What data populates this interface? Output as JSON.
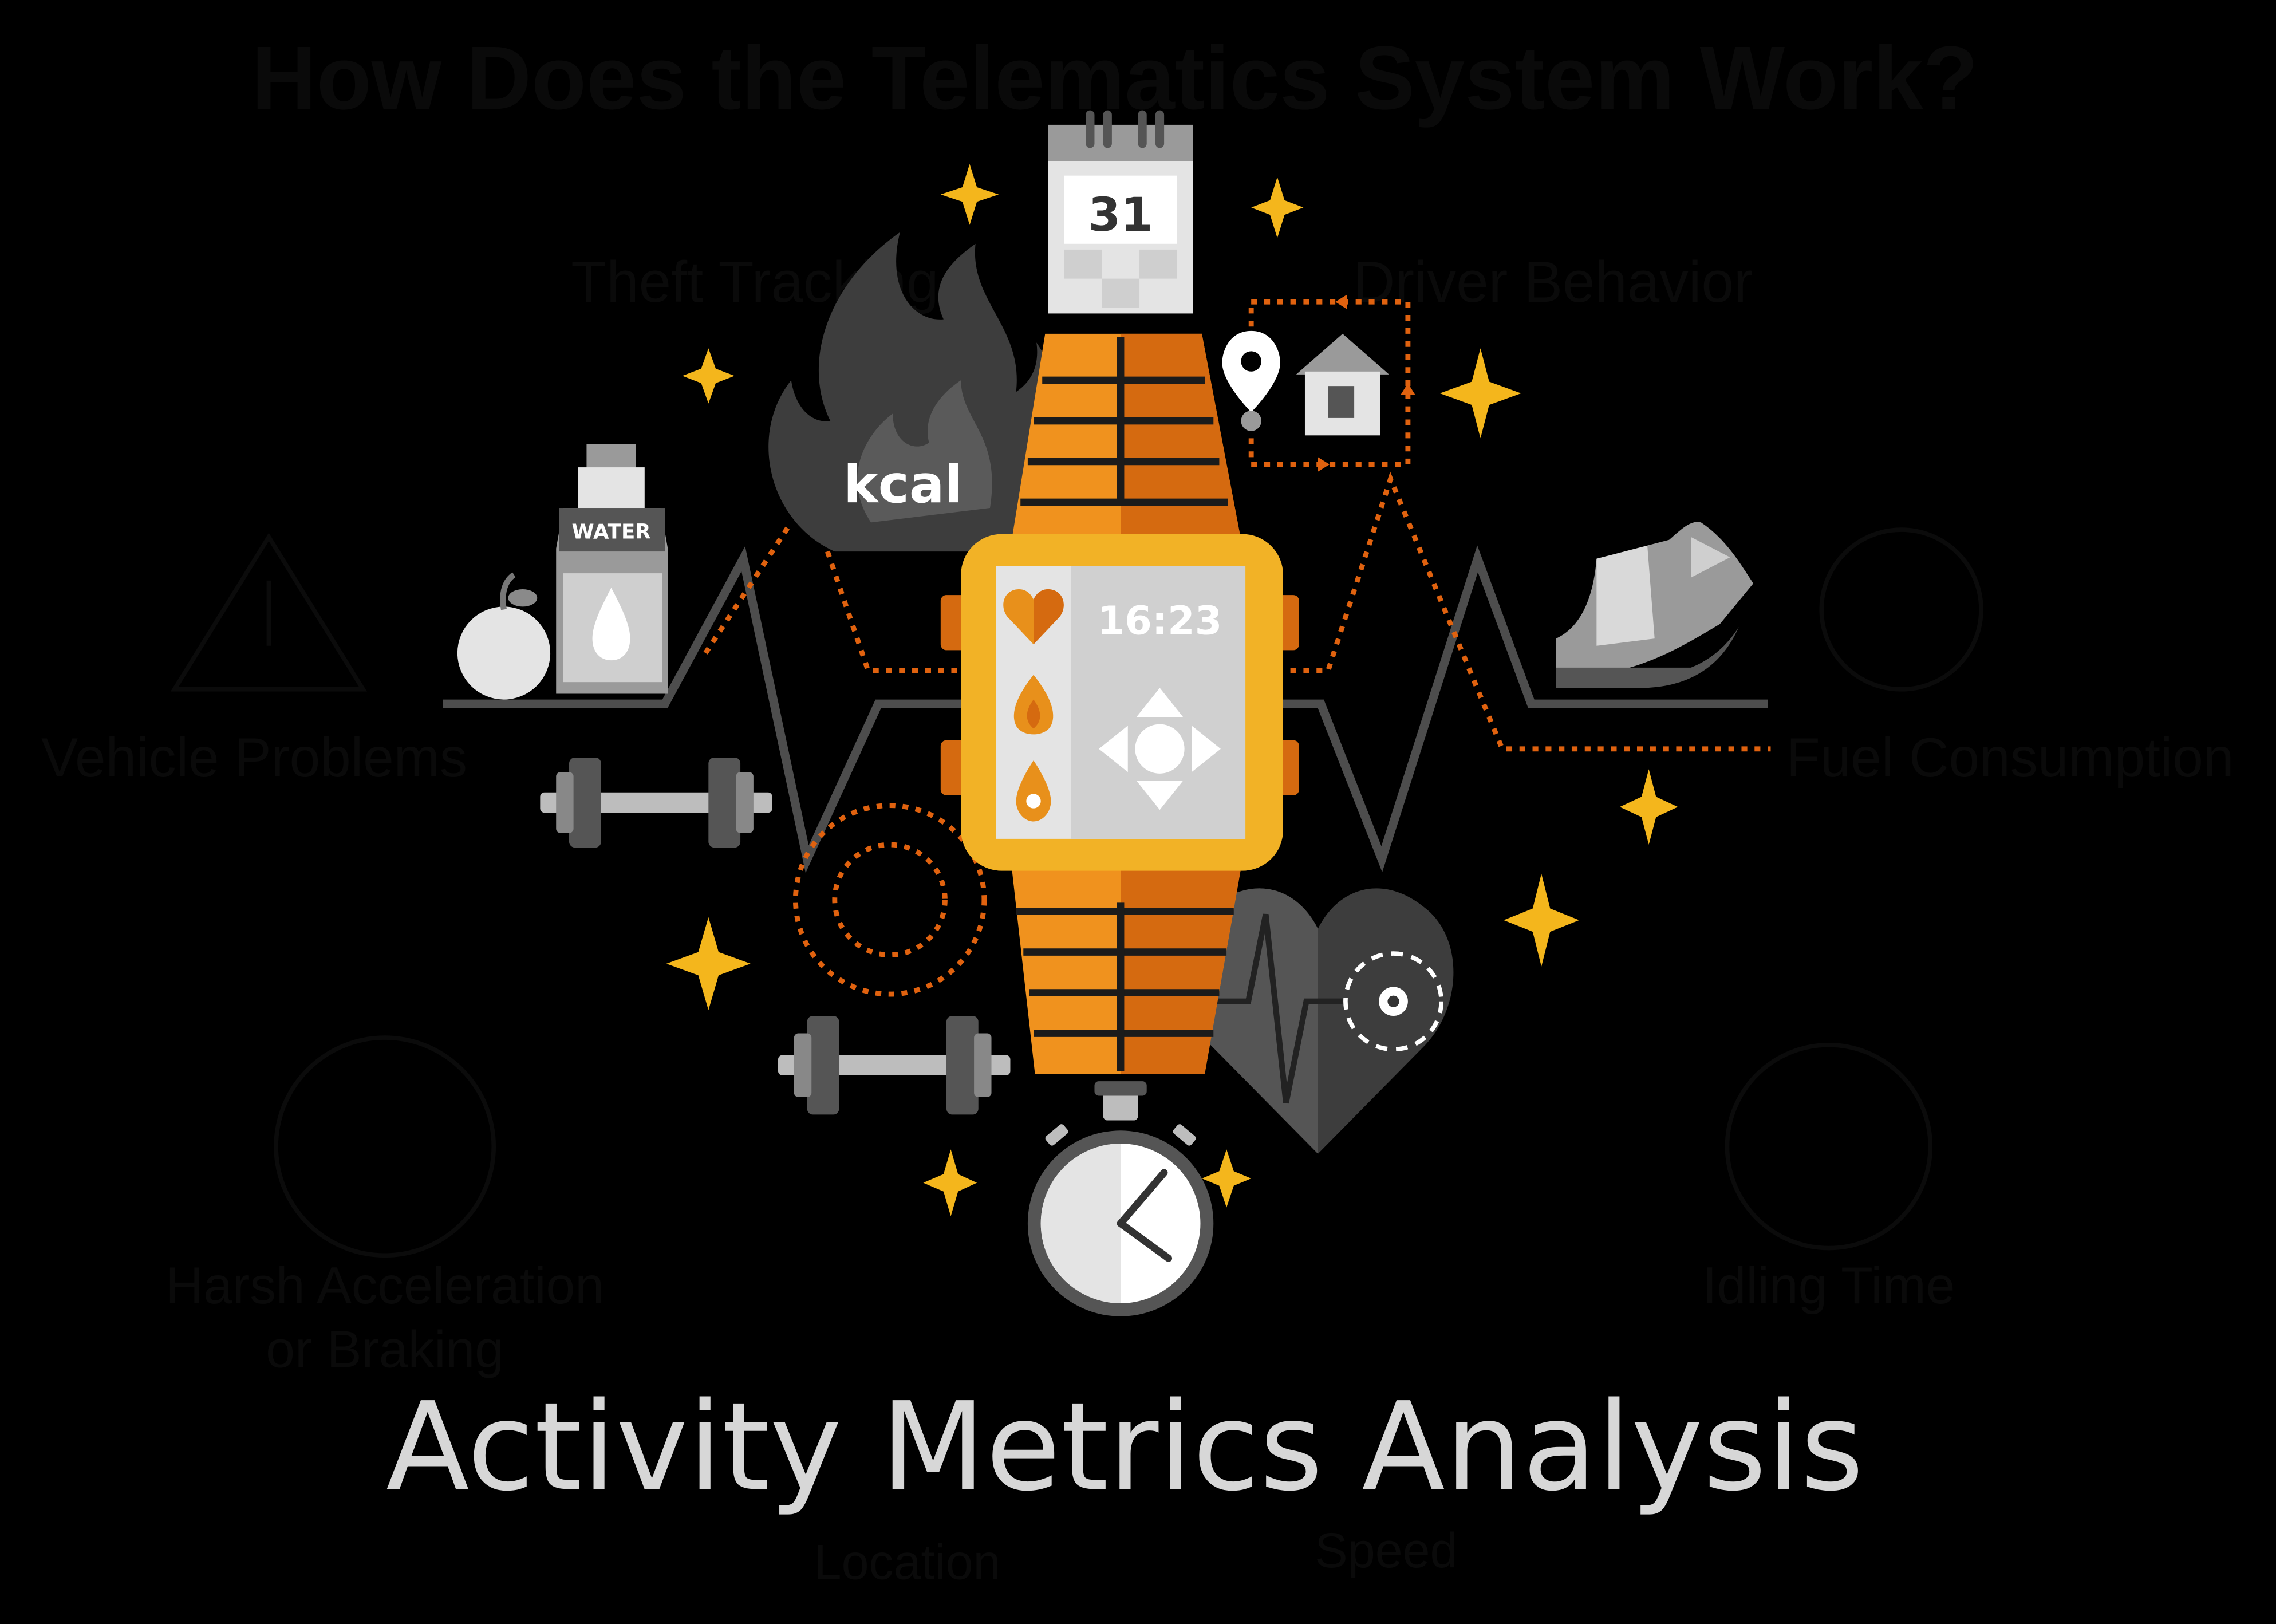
{
  "heading": "How Does the Telematics System Work?",
  "caption": "Activity Metrics Analysis",
  "background_labels": {
    "top": "Theft Tracking",
    "top_right": "Driver Behavior",
    "left": "Vehicle Problems",
    "right": "Fuel Consumption",
    "bottom_left_line1": "Harsh Acceleration",
    "bottom_left_line2": "or Braking",
    "bottom_right": "Idling Time",
    "bottom_center_left": "Location",
    "bottom_center_right": "Speed"
  },
  "icons": {
    "calendar_day": "31",
    "calorie_label": "kcal",
    "bottle_label": "WATER",
    "watch_time": "16:23"
  },
  "colors": {
    "background": "#000000",
    "accent_orange": "#f0921e",
    "dark_orange": "#d56a10",
    "watch_frame": "#f2b226",
    "sparkle": "#f4b61c",
    "dotted_path": "#e0620f",
    "icon_gray": "#4a4a4a",
    "caption": "#d7d7d7"
  }
}
